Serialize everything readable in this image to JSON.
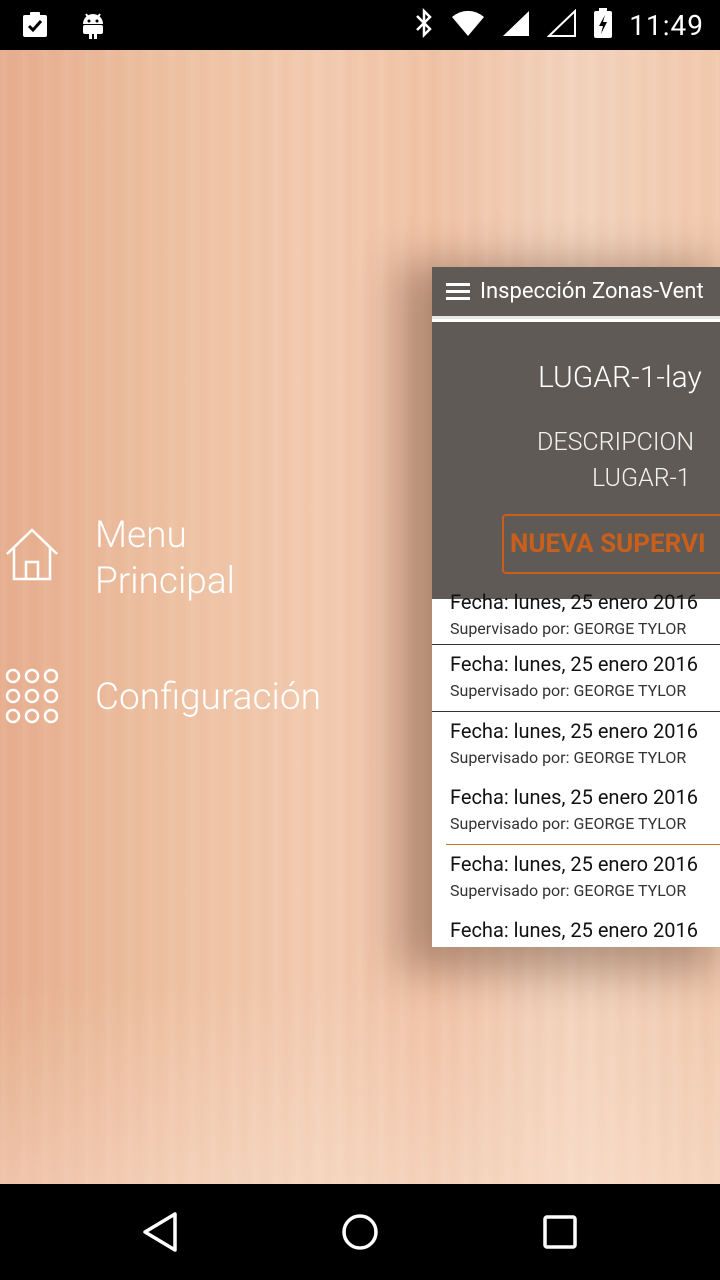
{
  "status_bar": {
    "time": "11:49",
    "icons": [
      "clipboard-check-icon",
      "android-icon",
      "bluetooth-icon",
      "wifi-icon",
      "signal-icon",
      "signal-empty-icon",
      "battery-charging-icon"
    ]
  },
  "side_menu": {
    "items": [
      {
        "label": "Menu Principal",
        "icon": "home-icon"
      },
      {
        "label": "Configuración",
        "icon": "grid-dots-icon"
      }
    ]
  },
  "preview": {
    "toolbar_title": "Inspección Zonas-Vent",
    "place_title": "LUGAR-1-lay",
    "description_label": "DESCRIPCION",
    "description_value": "LUGAR-1",
    "new_button_label": "NUEVA SUPERVI",
    "list": [
      {
        "date": "Fecha: lunes, 25 enero 2016",
        "by": "Supervisado por: GEORGE TYLOR"
      },
      {
        "date": "Fecha: lunes, 25 enero 2016",
        "by": "Supervisado por: GEORGE TYLOR"
      },
      {
        "date": "Fecha: lunes, 25 enero 2016",
        "by": "Supervisado por: GEORGE TYLOR"
      },
      {
        "date": "Fecha: lunes, 25 enero 2016",
        "by": "Supervisado por: GEORGE TYLOR"
      },
      {
        "date": "Fecha: lunes, 25 enero 2016",
        "by": "Supervisado por: GEORGE TYLOR"
      },
      {
        "date": "Fecha: lunes, 25 enero 2016",
        "by": ""
      }
    ],
    "accent_color": "#c95f1a",
    "header_color": "#5f5a56"
  },
  "nav_bar": {
    "buttons": [
      "back-icon",
      "home-circle-icon",
      "recents-icon"
    ]
  }
}
